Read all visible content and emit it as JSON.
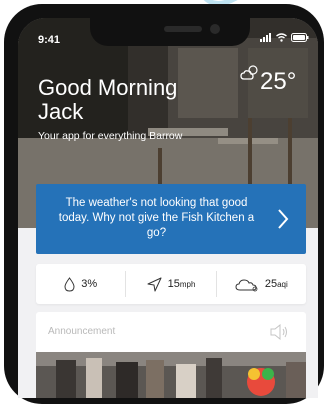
{
  "status": {
    "time": "9:41"
  },
  "hero": {
    "greeting": "Good Morning Jack",
    "tagline": "Your app for everything Barrow",
    "temperature": "25°"
  },
  "banner": {
    "text": "The weather's not looking that good today. Why not give the Fish Kitchen a go?"
  },
  "stats": {
    "rain_value": "3%",
    "wind_value": "15",
    "wind_unit": "mph",
    "air_value": "25",
    "air_unit": "aqi"
  },
  "announcement": {
    "title": "Announcement"
  },
  "colors": {
    "banner": "#2572b8",
    "background": "#f1f1f3"
  },
  "icons": [
    "weather-partly-cloudy-icon",
    "raindrop-icon",
    "wind-direction-icon",
    "cloud-air-quality-icon",
    "speaker-icon",
    "chevron-right-icon",
    "signal-icon",
    "wifi-icon",
    "battery-icon"
  ]
}
